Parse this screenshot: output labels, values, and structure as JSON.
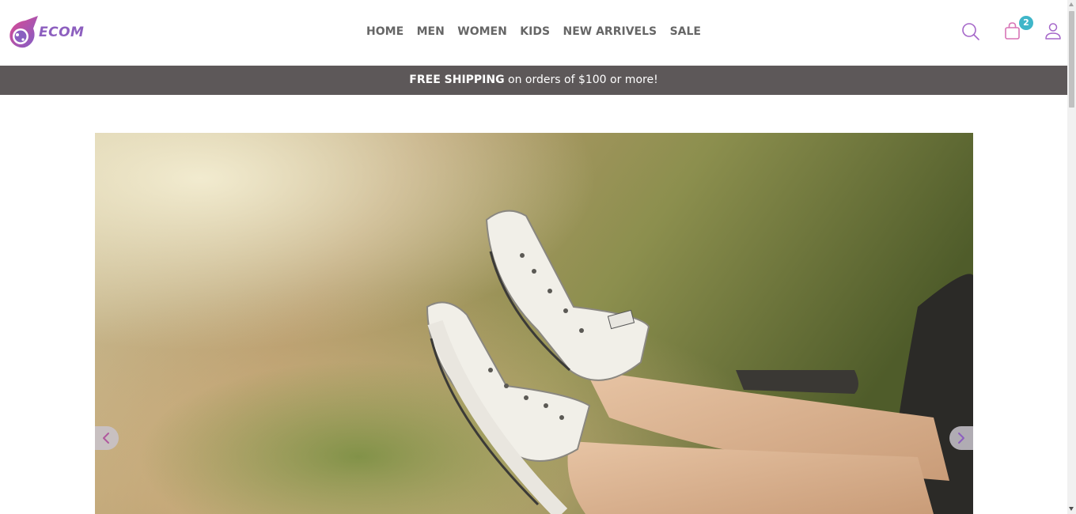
{
  "brand": {
    "logo_text": "ECOM"
  },
  "nav": {
    "items": [
      {
        "label": "HOME"
      },
      {
        "label": "MEN"
      },
      {
        "label": "WOMEN"
      },
      {
        "label": "KIDS"
      },
      {
        "label": "NEW ARRIVELS"
      },
      {
        "label": "SALE"
      }
    ]
  },
  "header_icons": {
    "search": "search-icon",
    "cart": "shopping-bag-icon",
    "user": "user-icon",
    "cart_count": "2"
  },
  "promo": {
    "strong": "FREE SHIPPING",
    "rest": " on orders of $100 or more!"
  },
  "hero": {
    "image": "sneakers-on-legs-photo",
    "prev_icon": "chevron-left-icon",
    "next_icon": "chevron-right-icon"
  },
  "colors": {
    "accent_purple": "#8d5fbf",
    "badge": "#3fb6c9",
    "promo_bg": "#5d5859"
  }
}
